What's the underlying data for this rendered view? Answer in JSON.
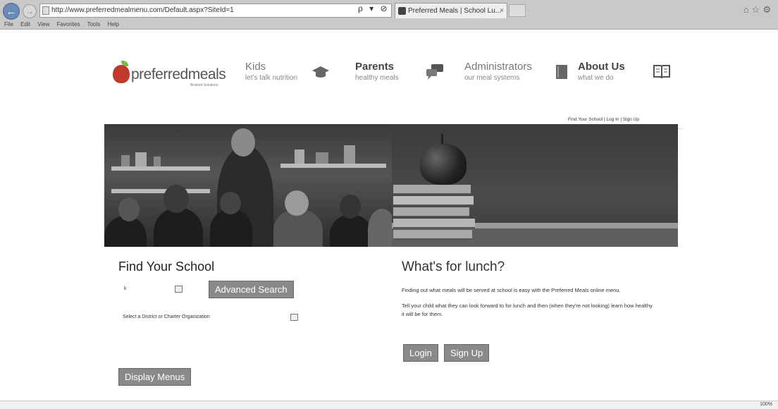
{
  "browser": {
    "address": "http://www.preferredmealmenu.com/Default.aspx?SiteId=1",
    "address_controls": "ρ ▾ ⊘ ✕",
    "tab_title": "Preferred Meals | School Lu...",
    "tab_close": "×",
    "menu": [
      "File",
      "Edit",
      "View",
      "Favorites",
      "Tools",
      "Help"
    ],
    "zoom": "100%"
  },
  "header": {
    "logo_text_a": "preferred",
    "logo_text_b": "meals",
    "logo_sub": "Bramed Solutions",
    "nav": [
      {
        "title": "Kids",
        "subtitle": "let's talk nutrition",
        "icon": "graduation-cap-icon"
      },
      {
        "title": "Parents",
        "subtitle": "healthy meals",
        "icon": "chat-bubbles-icon"
      },
      {
        "title": "Administrators",
        "subtitle": "our meal systems",
        "icon": "book-icon"
      },
      {
        "title": "About Us",
        "subtitle": "what we do",
        "icon": "open-book-icon"
      }
    ],
    "top_links": "Find Your School | Log In | Sign Up"
  },
  "find_school": {
    "title": "Find Your School",
    "first_field_value": "k",
    "advanced_search": "Advanced Search",
    "district_label": "Select a District or Charter Organization",
    "display_menus": "Display Menus"
  },
  "lunch": {
    "title": "What's for lunch?",
    "para1": "Finding out what meals will be served at school is easy with the Preferred Meals online menu.",
    "para2": "Tell your child what they can look forward to for lunch and then (when they're not looking) learn how healthy it will be for them.",
    "login": "Login",
    "signup": "Sign Up"
  }
}
